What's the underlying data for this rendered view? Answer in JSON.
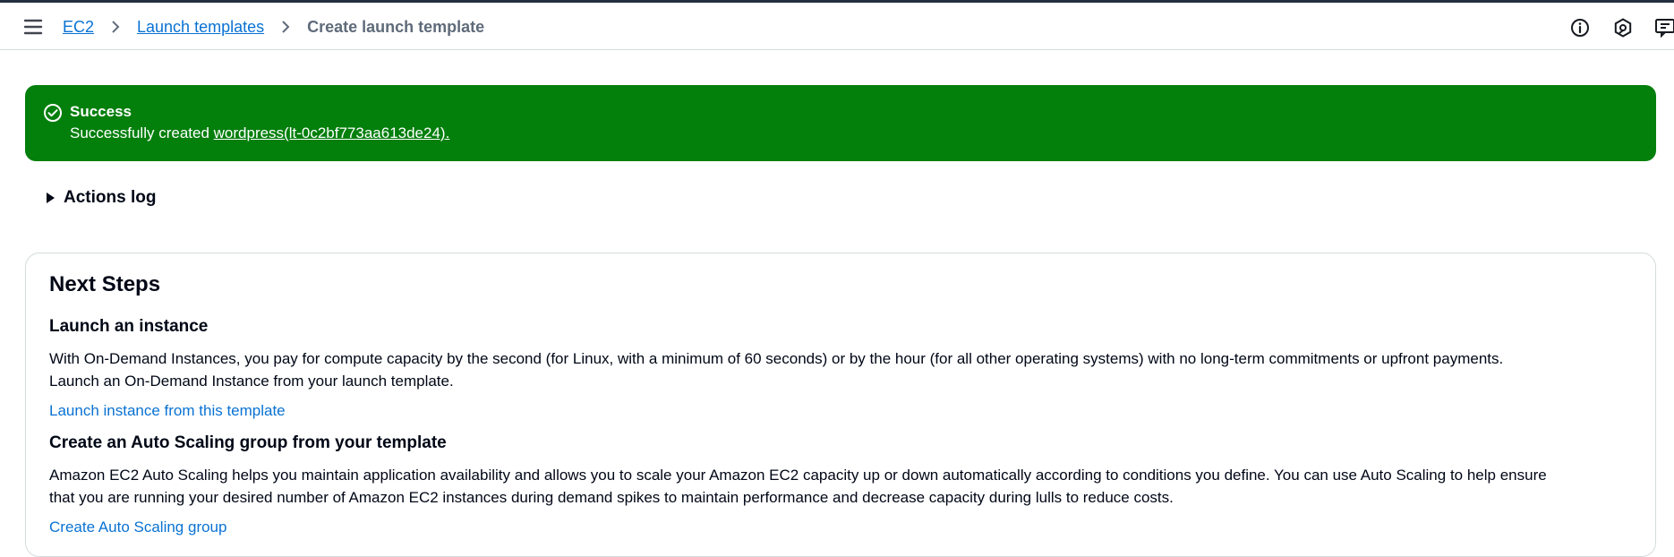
{
  "breadcrumb": {
    "items": [
      "EC2",
      "Launch templates"
    ],
    "current": "Create launch template"
  },
  "top_icons": [
    "info-icon",
    "settings-hex-icon",
    "feedback-icon"
  ],
  "flash": {
    "title": "Success",
    "message_prefix": "Successfully created ",
    "link_text": "wordpress(lt-0c2bf773aa613de24).",
    "color": "#037f0c"
  },
  "actions_log": {
    "label": "Actions log"
  },
  "next_steps": {
    "title": "Next Steps",
    "launch": {
      "title": "Launch an instance",
      "line1": "With On-Demand Instances, you pay for compute capacity by the second (for Linux, with a minimum of 60 seconds) or by the hour (for all other operating systems) with no long-term commitments or upfront payments.",
      "line2": "Launch an On-Demand Instance from your launch template.",
      "link": "Launch instance from this template"
    },
    "asg": {
      "title": "Create an Auto Scaling group from your template",
      "line1": "Amazon EC2 Auto Scaling helps you maintain application availability and allows you to scale your Amazon EC2 capacity up or down automatically according to conditions you define. You can use Auto Scaling to help ensure",
      "line2": "that you are running your desired number of Amazon EC2 instances during demand spikes to maintain performance and decrease capacity during lulls to reduce costs.",
      "link": "Create Auto Scaling group"
    }
  },
  "colors": {
    "link": "#0972d3",
    "text": "#000716",
    "border": "#d5dbdb"
  }
}
